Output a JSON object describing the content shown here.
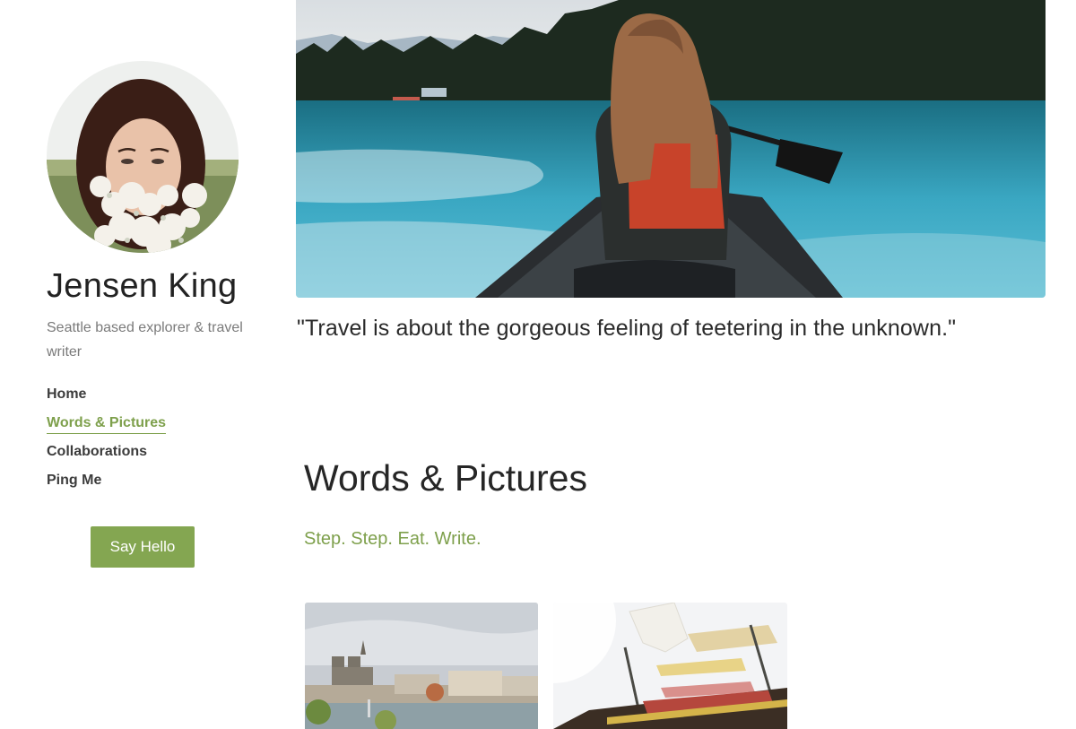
{
  "profile": {
    "name": "Jensen King",
    "tagline": "Seattle based explorer & travel writer"
  },
  "nav": {
    "items": [
      {
        "label": "Home",
        "active": false
      },
      {
        "label": "Words & Pictures",
        "active": true
      },
      {
        "label": "Collaborations",
        "active": false
      },
      {
        "label": "Ping Me",
        "active": false
      }
    ]
  },
  "cta": {
    "label": "Say Hello"
  },
  "hero": {
    "quote": "\"Travel is about the gorgeous feeling of teetering in the unknown.\""
  },
  "section": {
    "title": "Words & Pictures",
    "subtitle": "Step. Step. Eat. Write."
  },
  "colors": {
    "accent": "#7ea04c",
    "button": "#84a651",
    "text": "#2b2b2b",
    "muted": "#7a7a7a"
  }
}
